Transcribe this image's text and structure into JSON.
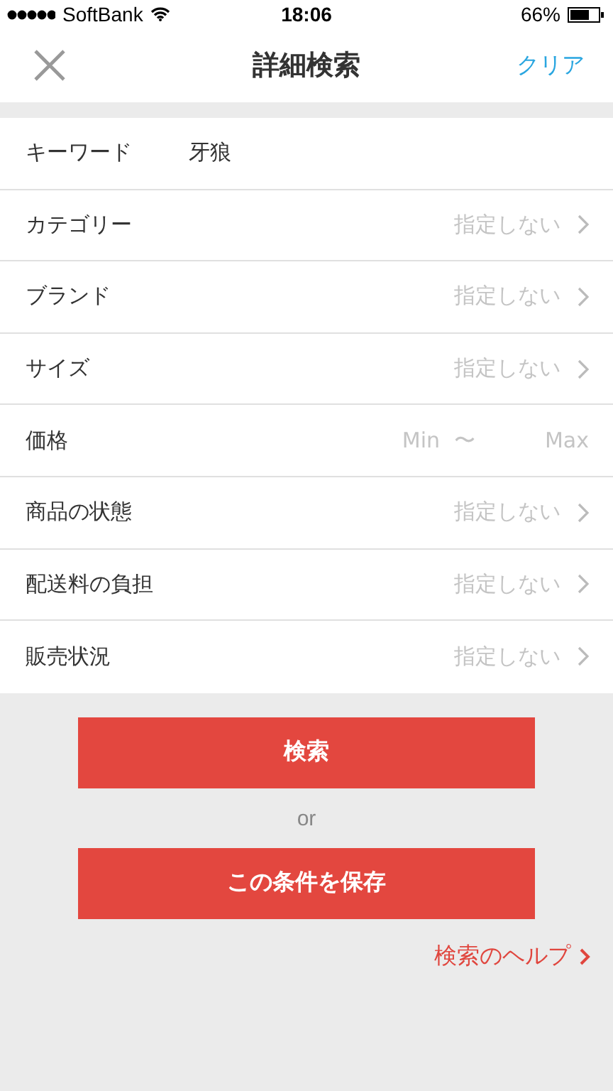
{
  "status_bar": {
    "carrier": "SoftBank",
    "time": "18:06",
    "battery": "66%"
  },
  "nav": {
    "title": "詳細検索",
    "action": "クリア"
  },
  "rows": [
    {
      "kind": "text",
      "label": "キーワード",
      "value": "牙狼"
    },
    {
      "kind": "select",
      "label": "カテゴリー",
      "value": "指定しない"
    },
    {
      "kind": "select",
      "label": "ブランド",
      "value": "指定しない"
    },
    {
      "kind": "select",
      "label": "サイズ",
      "value": "指定しない"
    },
    {
      "kind": "range",
      "label": "価格",
      "min_placeholder": "Min",
      "separator": "〜",
      "max_placeholder": "Max"
    },
    {
      "kind": "select",
      "label": "商品の状態",
      "value": "指定しない"
    },
    {
      "kind": "select",
      "label": "配送料の負担",
      "value": "指定しない"
    },
    {
      "kind": "select",
      "label": "販売状況",
      "value": "指定しない"
    }
  ],
  "search_button": "検索",
  "or": "or",
  "save_button": "この条件を保存",
  "help_link": "検索のヘルプ"
}
